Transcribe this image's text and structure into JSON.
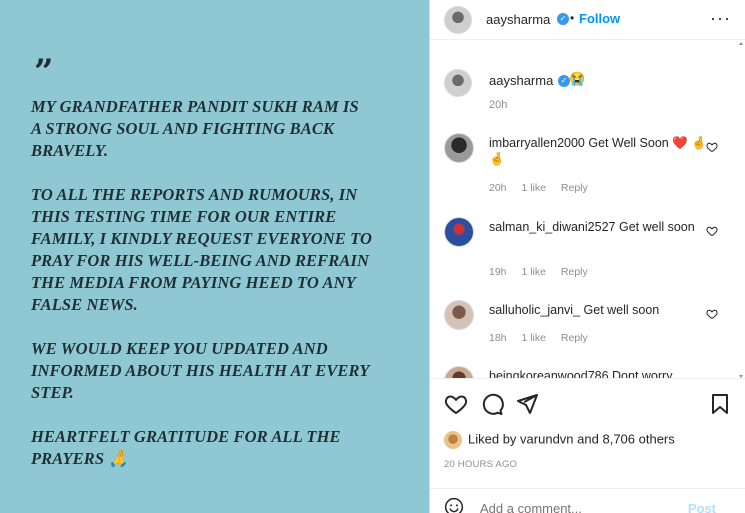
{
  "post": {
    "quote_mark": "”",
    "paragraphs": [
      "MY GRANDFATHER PANDIT SUKH RAM IS\nA STRONG SOUL AND FIGHTING BACK\nBRAVELY.",
      "TO ALL THE REPORTS AND RUMOURS, IN\nTHIS TESTING TIME FOR OUR ENTIRE\nFAMILY, I KINDLY REQUEST EVERYONE TO\nPRAY FOR HIS WELL-BEING AND REFRAIN\nTHE MEDIA FROM PAYING HEED TO ANY\nFALSE NEWS.",
      "WE WOULD KEEP YOU UPDATED AND\nINFORMED ABOUT HIS HEALTH AT EVERY\nSTEP.",
      "HEARTFELT GRATITUDE FOR ALL THE\nPRAYERS 🙏"
    ],
    "background_color": "#8fc8d3"
  },
  "header": {
    "username": "aaysharma",
    "separator": "•",
    "follow_label": "Follow",
    "more_label": "···"
  },
  "caption": {
    "username": "aaysharma",
    "emoji": "😭",
    "time": "20h"
  },
  "comments": [
    {
      "username": "imbarryallen2000",
      "text": "Get Well Soon ❤️ 🤞🤞",
      "time": "20h",
      "likes": "1 like",
      "reply": "Reply"
    },
    {
      "username": "salman_ki_diwani2527",
      "text": "Get well soon",
      "time": "19h",
      "likes": "1 like",
      "reply": "Reply"
    },
    {
      "username": "salluholic_janvi_",
      "text": "Get well soon",
      "time": "18h",
      "likes": "1 like",
      "reply": "Reply"
    },
    {
      "username": "beingkoreanwood786",
      "text": "Dont worry"
    }
  ],
  "likes": {
    "prefix": "Liked by",
    "user": "varundvn",
    "connector": "and",
    "others": "8,706 others"
  },
  "timestamp": "20 HOURS AGO",
  "add_comment": {
    "placeholder": "Add a comment...",
    "post_label": "Post"
  },
  "colors": {
    "link": "#0095f6",
    "verified": "#3897f0",
    "muted": "#8e8e8e"
  }
}
